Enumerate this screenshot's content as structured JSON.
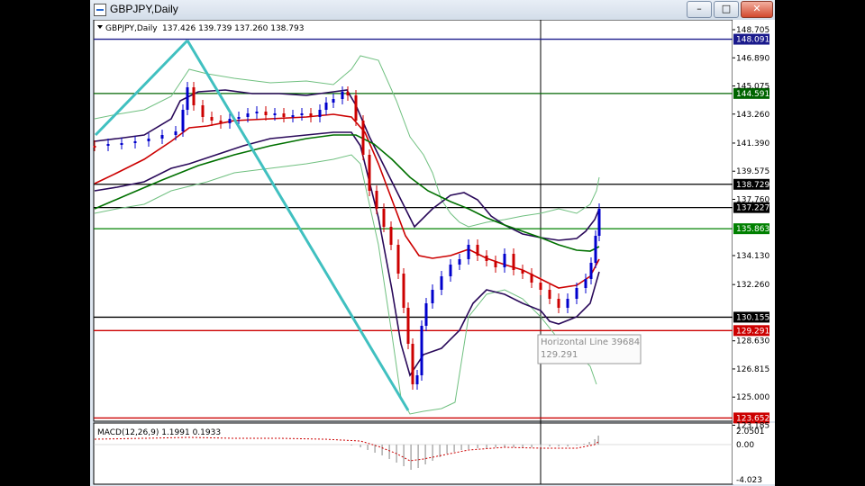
{
  "window": {
    "title": "GBPJPY,Daily",
    "buttons": {
      "minimize": "–",
      "maximize": "□",
      "close": "✕"
    }
  },
  "chart_header": {
    "symbol": "GBPJPY,Daily",
    "ohlc": "137.426 139.739 137.260 138.793"
  },
  "price_axis": {
    "ticks": [
      "148.705",
      "146.890",
      "145.075",
      "143.260",
      "141.390",
      "139.575",
      "137.760",
      "134.130",
      "132.260",
      "128.630",
      "126.815",
      "125.000",
      "123.185"
    ],
    "tick_values": [
      148.705,
      146.89,
      145.075,
      143.26,
      141.39,
      139.575,
      137.76,
      134.13,
      132.26,
      128.63,
      126.815,
      125.0,
      123.185
    ]
  },
  "horizontal_lines": [
    {
      "price": 148.091,
      "label": "148.091",
      "color": "#1a1a8c"
    },
    {
      "price": 144.591,
      "label": "144.591",
      "color": "#006400"
    },
    {
      "price": 138.729,
      "label": "138.729",
      "color": "#000000"
    },
    {
      "price": 137.227,
      "label": "137.227",
      "color": "#000000"
    },
    {
      "price": 135.863,
      "label": "135.863",
      "color": "#008000"
    },
    {
      "price": 130.155,
      "label": "130.155",
      "color": "#000000"
    },
    {
      "price": 129.291,
      "label": "129.291",
      "color": "#cc0000"
    },
    {
      "price": 123.652,
      "label": "123.652",
      "color": "#cc0000"
    }
  ],
  "tooltip": {
    "title": "Horizontal Line 39684",
    "value": "129.291"
  },
  "macd": {
    "label": "MACD(12,26,9) 1.1991 0.1933",
    "ticks": [
      "2.0501",
      "0.00",
      "-4.023"
    ]
  },
  "colors": {
    "up_candle": "#0000cc",
    "down_candle": "#cc0000",
    "trend_line": "#40c0c0",
    "ma_red": "#cc0000",
    "ma_green": "#007000",
    "band_purple": "#2a0a5a",
    "band_outer": "#70c080"
  }
}
